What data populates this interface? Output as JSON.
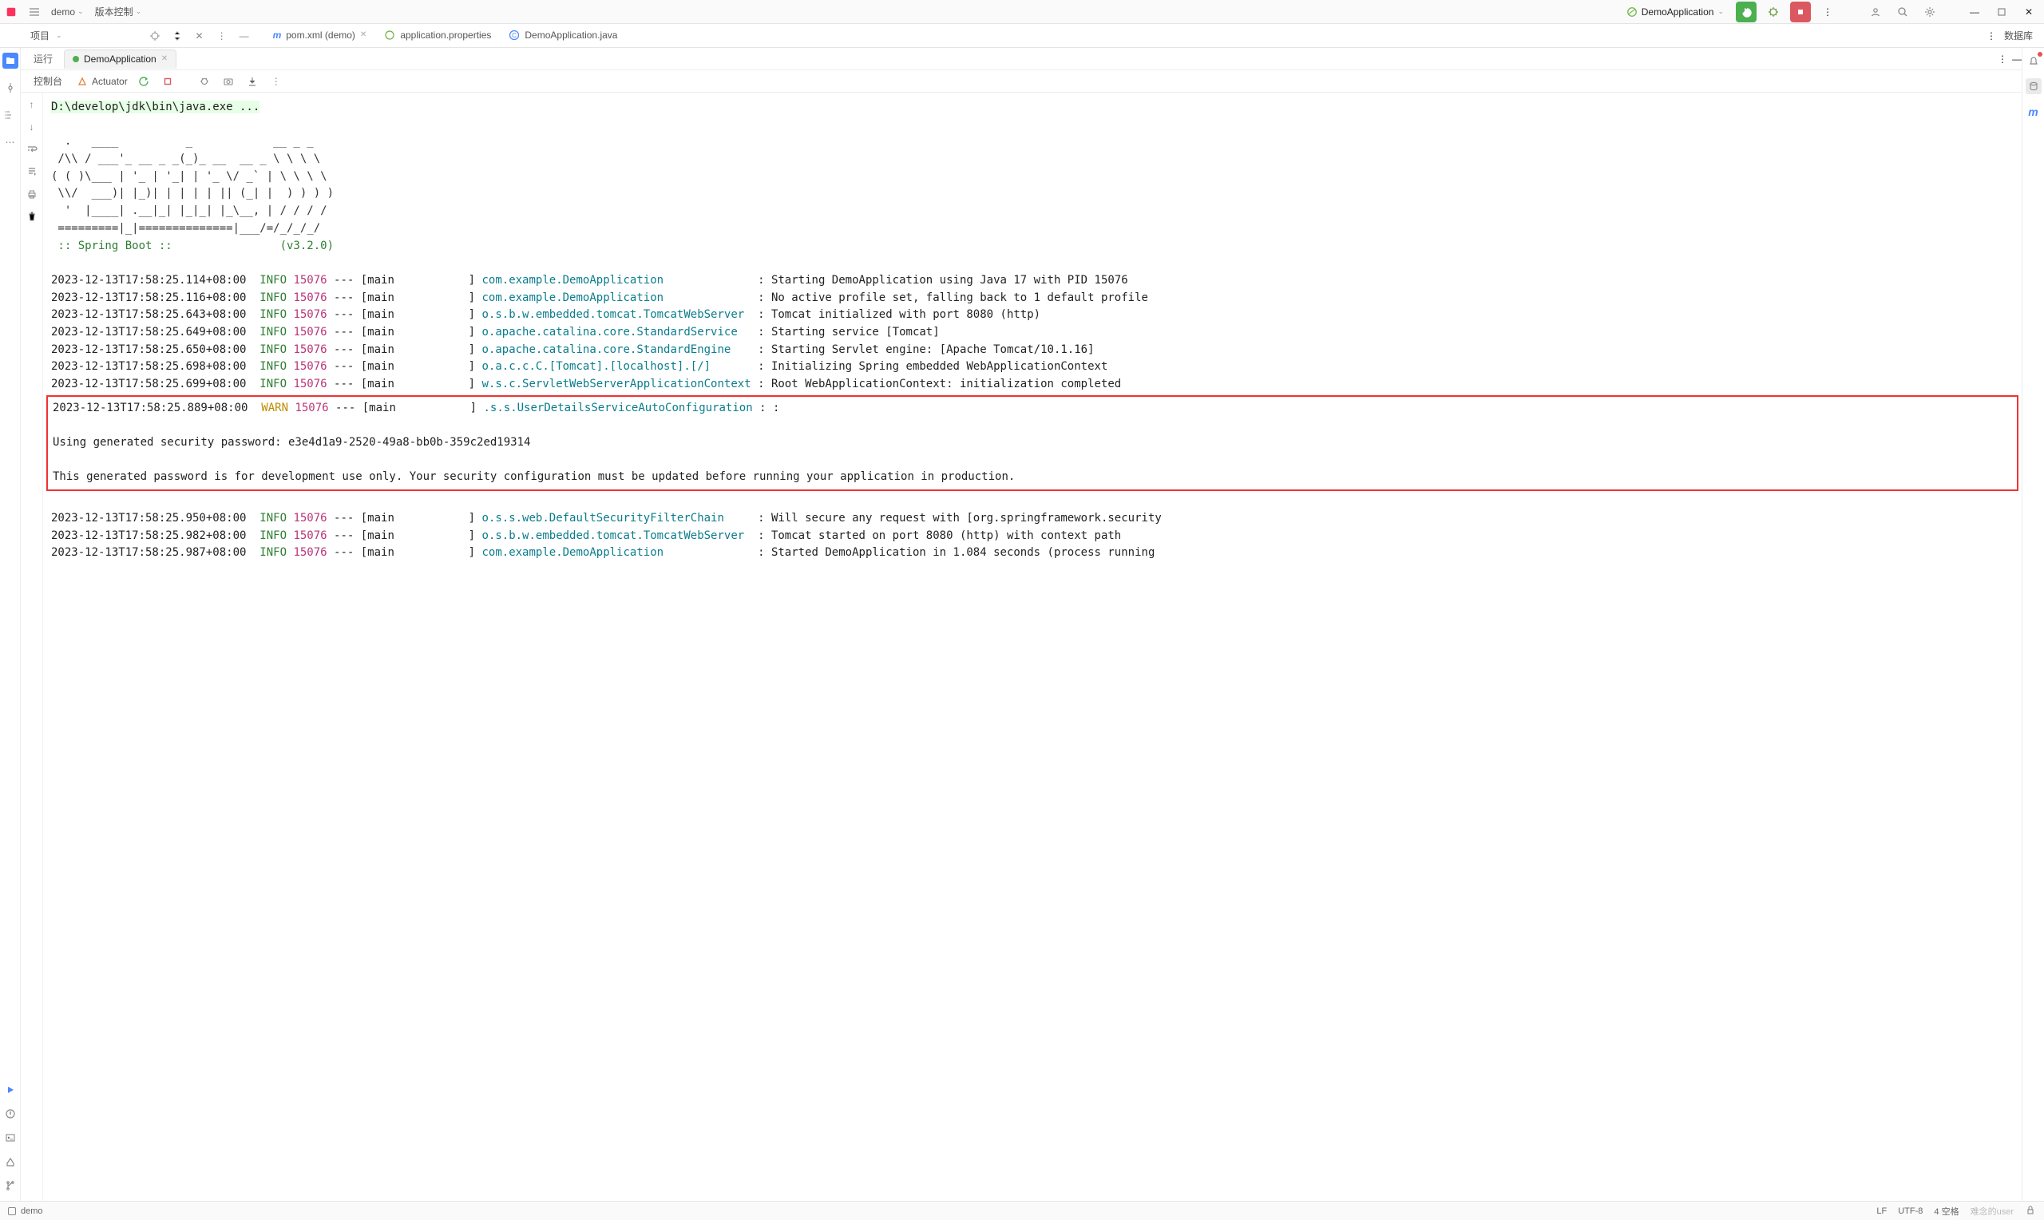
{
  "titlebar": {
    "project": "demo",
    "vcs": "版本控制",
    "run_config": "DemoApplication"
  },
  "nav": {
    "project_label": "项目",
    "tabs": [
      {
        "icon": "maven-icon",
        "label": "pom.xml (demo)"
      },
      {
        "icon": "spring-icon",
        "label": "application.properties"
      },
      {
        "icon": "java-icon",
        "label": "DemoApplication.java"
      }
    ],
    "db_label": "数据库"
  },
  "run_panel": {
    "run_label": "运行",
    "active_tab": "DemoApplication",
    "console_label": "控制台",
    "actuator_label": "Actuator"
  },
  "console": {
    "command": "D:\\develop\\jdk\\bin\\java.exe ...",
    "banner": "  .   ____          _            __ _ _\n /\\\\ / ___'_ __ _ _(_)_ __  __ _ \\ \\ \\ \\\n( ( )\\___ | '_ | '_| | '_ \\/ _` | \\ \\ \\ \\\n \\\\/  ___)| |_)| | | | | || (_| |  ) ) ) )\n  '  |____| .__|_| |_|_| |_\\__, | / / / /\n =========|_|==============|___/=/_/_/_/",
    "springboot_line": " :: Spring Boot ::                (v3.2.0)",
    "lines_before": [
      {
        "ts": "2023-12-13T17:58:25.114+08:00",
        "level": "INFO",
        "pid": "15076",
        "thread": "main",
        "logger": "com.example.DemoApplication",
        "msg": "Starting DemoApplication using Java 17 with PID 15076"
      },
      {
        "ts": "2023-12-13T17:58:25.116+08:00",
        "level": "INFO",
        "pid": "15076",
        "thread": "main",
        "logger": "com.example.DemoApplication",
        "msg": "No active profile set, falling back to 1 default profile"
      },
      {
        "ts": "2023-12-13T17:58:25.643+08:00",
        "level": "INFO",
        "pid": "15076",
        "thread": "main",
        "logger": "o.s.b.w.embedded.tomcat.TomcatWebServer",
        "msg": "Tomcat initialized with port 8080 (http)"
      },
      {
        "ts": "2023-12-13T17:58:25.649+08:00",
        "level": "INFO",
        "pid": "15076",
        "thread": "main",
        "logger": "o.apache.catalina.core.StandardService",
        "msg": "Starting service [Tomcat]"
      },
      {
        "ts": "2023-12-13T17:58:25.650+08:00",
        "level": "INFO",
        "pid": "15076",
        "thread": "main",
        "logger": "o.apache.catalina.core.StandardEngine",
        "msg": "Starting Servlet engine: [Apache Tomcat/10.1.16]"
      },
      {
        "ts": "2023-12-13T17:58:25.698+08:00",
        "level": "INFO",
        "pid": "15076",
        "thread": "main",
        "logger": "o.a.c.c.C.[Tomcat].[localhost].[/]",
        "msg": "Initializing Spring embedded WebApplicationContext"
      },
      {
        "ts": "2023-12-13T17:58:25.699+08:00",
        "level": "INFO",
        "pid": "15076",
        "thread": "main",
        "logger": "w.s.c.ServletWebServerApplicationContext",
        "msg": "Root WebApplicationContext: initialization completed"
      }
    ],
    "warn_line": {
      "ts": "2023-12-13T17:58:25.889+08:00",
      "level": "WARN",
      "pid": "15076",
      "thread": "main",
      "logger": ".s.s.UserDetailsServiceAutoConfiguration",
      "msg": ":"
    },
    "warn_body1": "Using generated security password: e3e4d1a9-2520-49a8-bb0b-359c2ed19314",
    "warn_body2": "This generated password is for development use only. Your security configuration must be updated before running your application in production.",
    "lines_after": [
      {
        "ts": "2023-12-13T17:58:25.950+08:00",
        "level": "INFO",
        "pid": "15076",
        "thread": "main",
        "logger": "o.s.s.web.DefaultSecurityFilterChain",
        "msg": "Will secure any request with [org.springframework.security"
      },
      {
        "ts": "2023-12-13T17:58:25.982+08:00",
        "level": "INFO",
        "pid": "15076",
        "thread": "main",
        "logger": "o.s.b.w.embedded.tomcat.TomcatWebServer",
        "msg": "Tomcat started on port 8080 (http) with context path "
      },
      {
        "ts": "2023-12-13T17:58:25.987+08:00",
        "level": "INFO",
        "pid": "15076",
        "thread": "main",
        "logger": "com.example.DemoApplication",
        "msg": "Started DemoApplication in 1.084 seconds (process running"
      }
    ]
  },
  "statusbar": {
    "project": "demo",
    "encoding": "LF",
    "charset": "UTF-8",
    "indent": "4 空格",
    "watermark": "难念的user"
  }
}
